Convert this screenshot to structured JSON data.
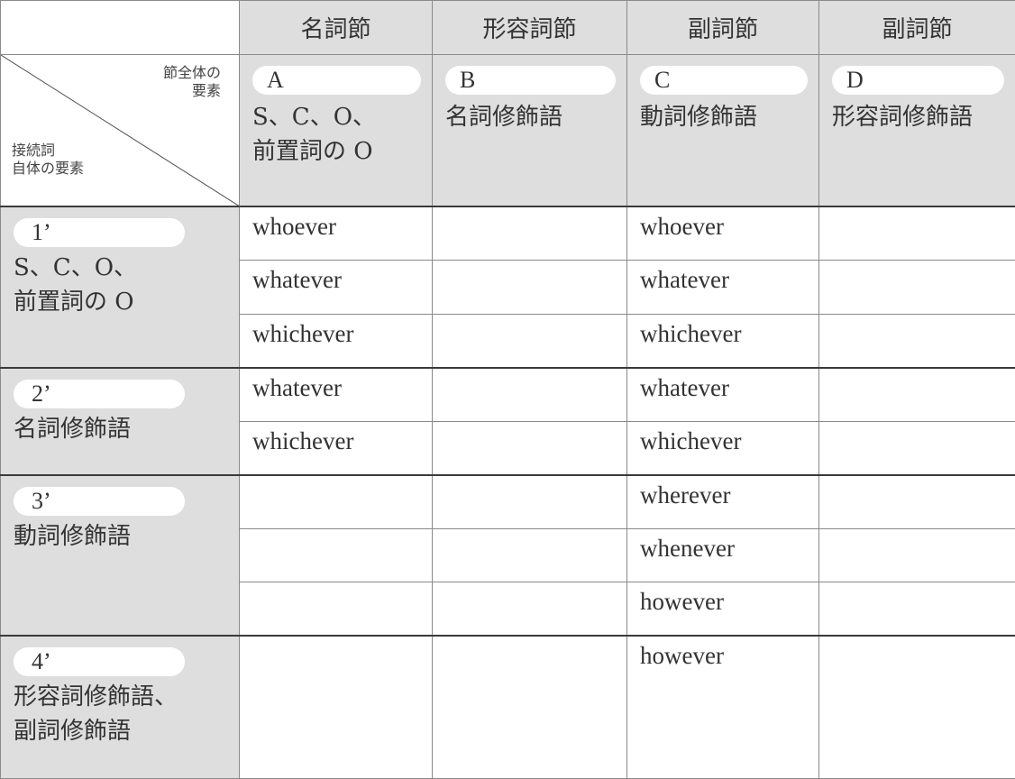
{
  "corner": {
    "top_label_1": "節全体の",
    "top_label_2": "要素",
    "bottom_label_1": "接続詞",
    "bottom_label_2": "自体の要素"
  },
  "column_headers": [
    "名詞節",
    "形容詞節",
    "副詞節",
    "副詞節"
  ],
  "columns": [
    {
      "letter": "A",
      "desc_1": "S、C、O、",
      "desc_2": "前置詞の O"
    },
    {
      "letter": "B",
      "desc_1": "名詞修飾語",
      "desc_2": ""
    },
    {
      "letter": "C",
      "desc_1": "動詞修飾語",
      "desc_2": ""
    },
    {
      "letter": "D",
      "desc_1": "形容詞修飾語",
      "desc_2": ""
    }
  ],
  "rows": [
    {
      "label": "1’",
      "desc_1": "S、C、O、",
      "desc_2": "前置詞の O",
      "entries": [
        [
          "whoever",
          "",
          "whoever",
          ""
        ],
        [
          "whatever",
          "",
          "whatever",
          ""
        ],
        [
          "whichever",
          "",
          "whichever",
          ""
        ]
      ]
    },
    {
      "label": "2’",
      "desc_1": "名詞修飾語",
      "desc_2": "",
      "entries": [
        [
          "whatever",
          "",
          "whatever",
          ""
        ],
        [
          "whichever",
          "",
          "whichever",
          ""
        ]
      ]
    },
    {
      "label": "3’",
      "desc_1": "動詞修飾語",
      "desc_2": "",
      "entries": [
        [
          "",
          "",
          "wherever",
          ""
        ],
        [
          "",
          "",
          "whenever",
          ""
        ],
        [
          "",
          "",
          "however",
          ""
        ]
      ]
    },
    {
      "label": "4’",
      "desc_1": "形容詞修飾語、",
      "desc_2": "副詞修飾語",
      "entries": [
        [
          "",
          "",
          "however",
          ""
        ]
      ]
    }
  ],
  "colors": {
    "shade": "#dedede",
    "border": "#8a8a8a",
    "text": "#333333"
  }
}
